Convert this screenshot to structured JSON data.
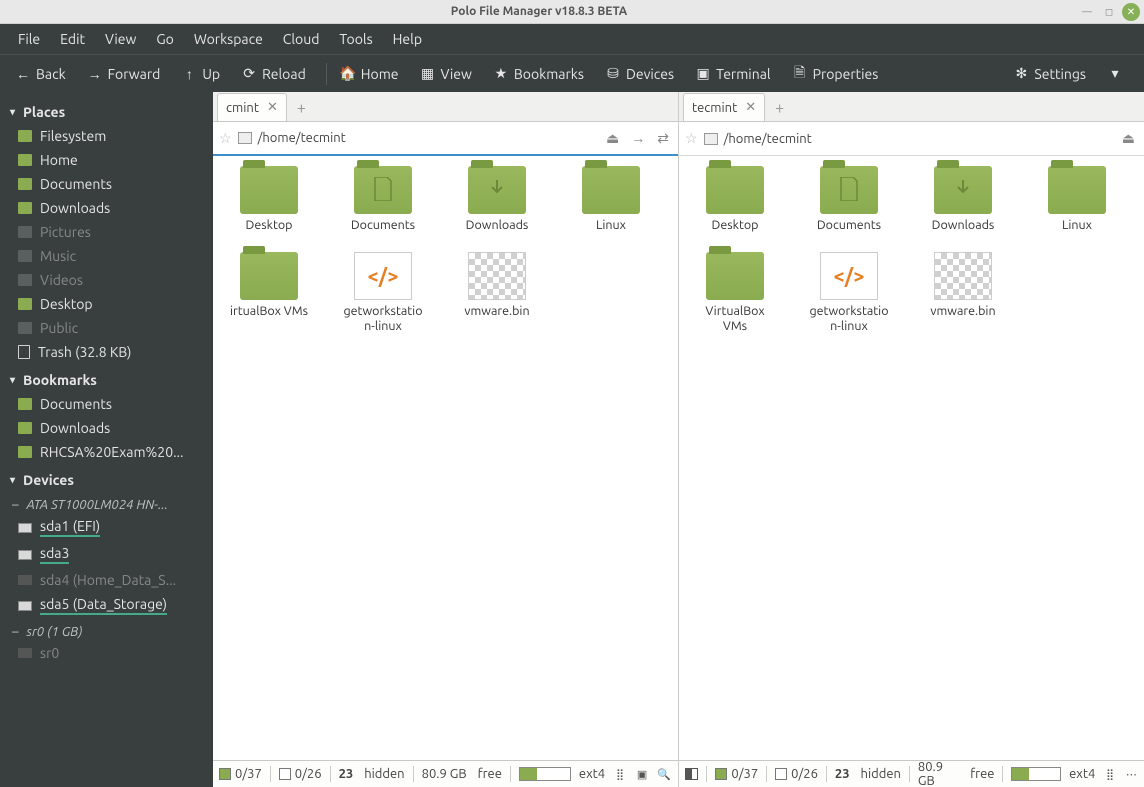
{
  "window": {
    "title": "Polo File Manager v18.8.3 BETA"
  },
  "menubar": [
    "File",
    "Edit",
    "View",
    "Go",
    "Workspace",
    "Cloud",
    "Tools",
    "Help"
  ],
  "toolbar": {
    "back": "Back",
    "forward": "Forward",
    "up": "Up",
    "reload": "Reload",
    "home": "Home",
    "view": "View",
    "bookmarks": "Bookmarks",
    "devices": "Devices",
    "terminal": "Terminal",
    "properties": "Properties",
    "settings": "Settings"
  },
  "sidebar": {
    "places_header": "Places",
    "places": [
      {
        "label": "Filesystem",
        "dim": false
      },
      {
        "label": "Home",
        "dim": false
      },
      {
        "label": "Documents",
        "dim": false
      },
      {
        "label": "Downloads",
        "dim": false
      },
      {
        "label": "Pictures",
        "dim": true
      },
      {
        "label": "Music",
        "dim": true
      },
      {
        "label": "Videos",
        "dim": true
      },
      {
        "label": "Desktop",
        "dim": false
      },
      {
        "label": "Public",
        "dim": true
      }
    ],
    "trash": "Trash (32.8 KB)",
    "bookmarks_header": "Bookmarks",
    "bookmarks": [
      {
        "label": "Documents"
      },
      {
        "label": "Downloads"
      },
      {
        "label": "RHCSA%20Exam%20..."
      }
    ],
    "devices_header": "Devices",
    "disk_header": "ATA ST1000LM024 HN-...",
    "partitions": [
      {
        "label": "sda1 (EFI)",
        "mounted": true,
        "underlined": true
      },
      {
        "label": "sda3",
        "mounted": true,
        "underlined": true
      },
      {
        "label": "sda4 (Home_Data_S...",
        "mounted": false,
        "underlined": false
      },
      {
        "label": "sda5 (Data_Storage)",
        "mounted": true,
        "underlined": true
      }
    ],
    "optical_header": "sr0 (1 GB)",
    "optical": [
      {
        "label": "sr0",
        "mounted": false
      }
    ]
  },
  "panes": [
    {
      "tab_label": "cmint",
      "tab_truncated": true,
      "path": "/home/tecmint",
      "active": true,
      "items": [
        {
          "name": "Desktop",
          "type": "folder"
        },
        {
          "name": "Documents",
          "type": "folder",
          "inner": "doc"
        },
        {
          "name": "Downloads",
          "type": "folder",
          "inner": "down"
        },
        {
          "name": "Linux",
          "type": "folder"
        },
        {
          "name": "irtualBox VMs",
          "type": "folder",
          "truncated": true
        },
        {
          "name": "getworkstation-linux",
          "type": "file-code"
        },
        {
          "name": "vmware.bin",
          "type": "file-bin"
        }
      ]
    },
    {
      "tab_label": "tecmint",
      "tab_truncated": false,
      "path": "/home/tecmint",
      "active": false,
      "items": [
        {
          "name": "Desktop",
          "type": "folder"
        },
        {
          "name": "Documents",
          "type": "folder",
          "inner": "doc"
        },
        {
          "name": "Downloads",
          "type": "folder",
          "inner": "down"
        },
        {
          "name": "Linux",
          "type": "folder"
        },
        {
          "name": "VirtualBox VMs",
          "type": "folder"
        },
        {
          "name": "getworkstation-linux",
          "type": "file-code"
        },
        {
          "name": "vmware.bin",
          "type": "file-bin"
        }
      ]
    }
  ],
  "status": {
    "folders": "0/37",
    "files": "0/26",
    "hidden_count": "23",
    "hidden_label": "hidden",
    "free": "80.9 GB",
    "free_label": "free",
    "fs": "ext4"
  }
}
